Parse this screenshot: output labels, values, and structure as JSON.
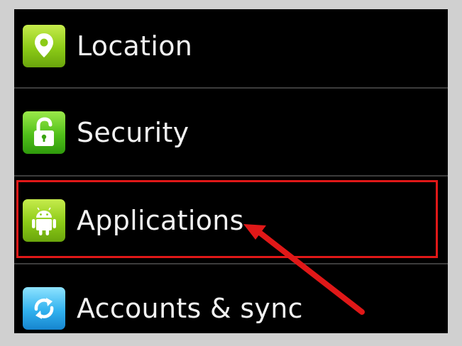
{
  "settings_list": {
    "items": [
      {
        "label": "Location",
        "icon": "location-pin-icon"
      },
      {
        "label": "Security",
        "icon": "padlock-icon"
      },
      {
        "label": "Applications",
        "icon": "android-robot-icon"
      },
      {
        "label": "Accounts & sync",
        "icon": "sync-arrows-icon"
      }
    ]
  },
  "annotation": {
    "highlight_color": "#e01818",
    "highlighted_item": "Applications"
  }
}
